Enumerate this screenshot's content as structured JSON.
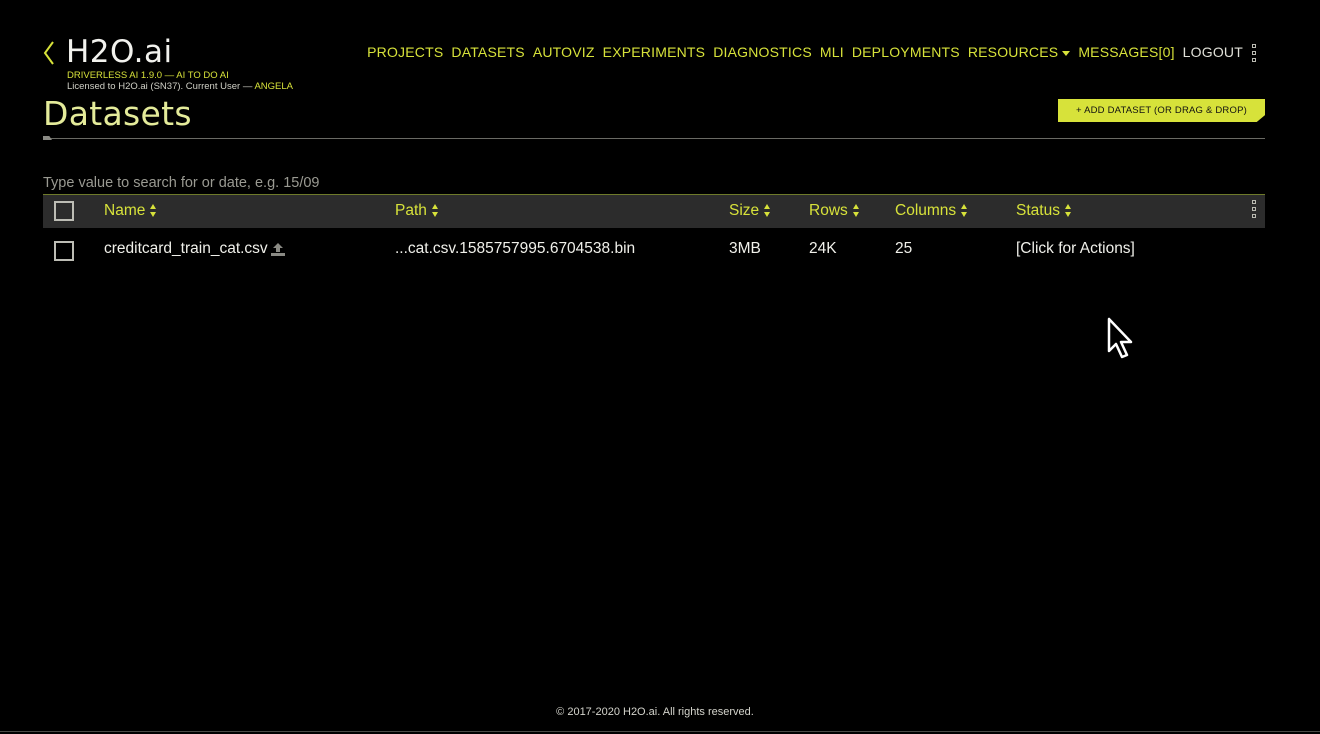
{
  "header": {
    "brand": "H2O.ai",
    "product_line": "DRIVERLESS AI 1.9.0 — AI TO DO AI",
    "license_prefix": "Licensed to H2O.ai (SN37). Current User — ",
    "current_user": "ANGELA"
  },
  "nav": {
    "projects": "PROJECTS",
    "datasets": "DATASETS",
    "autoviz": "AUTOVIZ",
    "experiments": "EXPERIMENTS",
    "diagnostics": "DIAGNOSTICS",
    "mli": "MLI",
    "deployments": "DEPLOYMENTS",
    "resources": "RESOURCES",
    "messages": "MESSAGES[0]",
    "logout": "LOGOUT"
  },
  "page": {
    "title": "Datasets",
    "add_button": "+ ADD DATASET (OR DRAG & DROP)"
  },
  "search": {
    "placeholder": "Type value to search for or date, e.g. 15/09",
    "value": ""
  },
  "table": {
    "columns": {
      "name": "Name",
      "path": "Path",
      "size": "Size",
      "rows": "Rows",
      "columns": "Columns",
      "status": "Status"
    },
    "rows": [
      {
        "name": "creditcard_train_cat.csv",
        "path": "...cat.csv.1585757995.6704538.bin",
        "size": "3MB",
        "rows": "24K",
        "columns": "25",
        "status": "[Click for Actions]"
      }
    ]
  },
  "footer": {
    "copyright": "© 2017-2020 H2O.ai. All rights reserved."
  },
  "colors": {
    "accent": "#d7e23a",
    "background": "#000000",
    "header_row": "#2c2c2c"
  }
}
